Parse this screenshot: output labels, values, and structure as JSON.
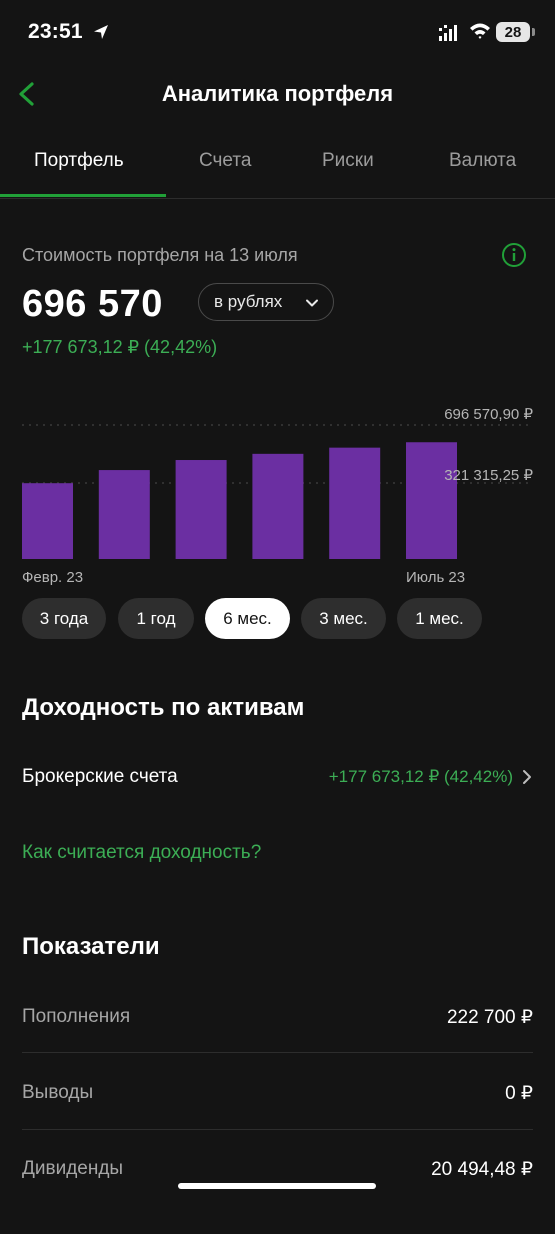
{
  "status_bar": {
    "time": "23:51",
    "battery": "28"
  },
  "header": {
    "title": "Аналитика портфеля"
  },
  "tabs": [
    {
      "label": "Портфель",
      "active": true
    },
    {
      "label": "Счета",
      "active": false
    },
    {
      "label": "Риски",
      "active": false
    },
    {
      "label": "Валюта",
      "active": false
    }
  ],
  "portfolio": {
    "label": "Стоимость портфеля на 13 июля",
    "value": "696 570",
    "currency_selector": "в рублях",
    "change": "+177 673,12 ₽ (42,42%)"
  },
  "chart_data": {
    "type": "bar",
    "categories": [
      "Февр. 23",
      "",
      "",
      "",
      "",
      "Июль 23"
    ],
    "values": [
      320000,
      405000,
      470000,
      510000,
      550000,
      585000
    ],
    "reference_lines": [
      {
        "label": "696 570,90 ₽",
        "value": 696570.9
      },
      {
        "label": "321 315,25 ₽",
        "value": 321315.25
      }
    ],
    "x_tick_labels": [
      "Февр. 23",
      "Июль 23"
    ],
    "bar_color": "#6b2fa2",
    "grid": false
  },
  "periods": [
    {
      "label": "3 года",
      "active": false
    },
    {
      "label": "1 год",
      "active": false
    },
    {
      "label": "6 мес.",
      "active": true
    },
    {
      "label": "3 мес.",
      "active": false
    },
    {
      "label": "1 мес.",
      "active": false
    }
  ],
  "returns": {
    "title": "Доходность по активам",
    "broker_label": "Брокерские счета",
    "broker_value": "+177 673,12 ₽ (42,42%)",
    "how_link": "Как считается доходность?"
  },
  "metrics": {
    "title": "Показатели",
    "rows": [
      {
        "label": "Пополнения",
        "value": "222 700 ₽"
      },
      {
        "label": "Выводы",
        "value": "0 ₽"
      },
      {
        "label": "Дивиденды",
        "value": "20 494,48 ₽"
      }
    ]
  },
  "colors": {
    "accent": "#3cae55",
    "bar": "#6b2fa2",
    "background": "#141414"
  }
}
